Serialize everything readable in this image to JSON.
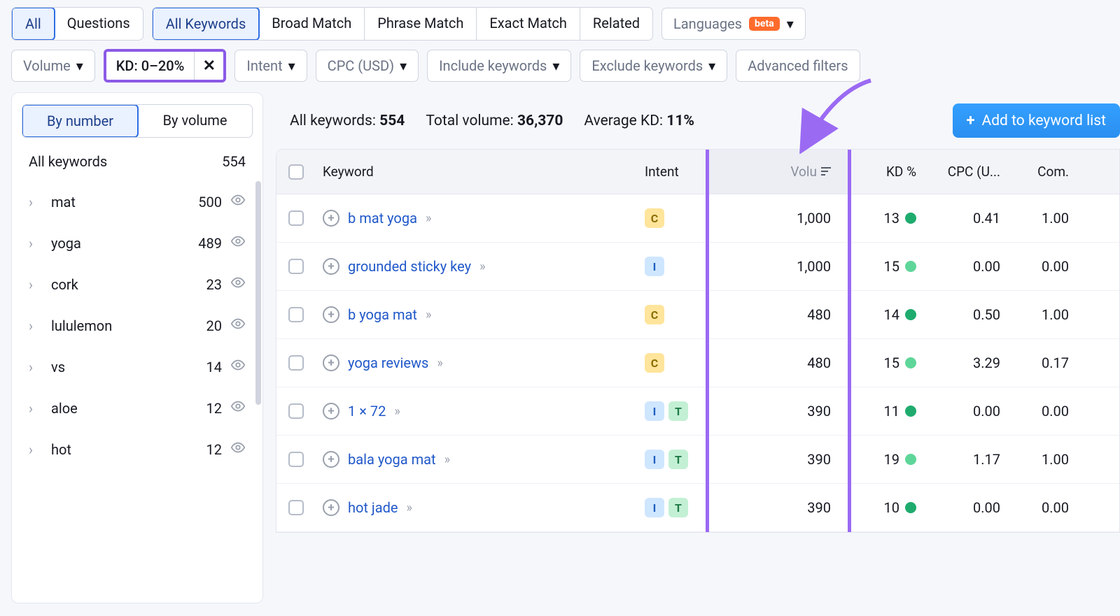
{
  "toptabs": {
    "group1": [
      {
        "label": "All",
        "active": true
      },
      {
        "label": "Questions",
        "active": false
      }
    ],
    "group2": [
      {
        "label": "All Keywords",
        "active": true
      },
      {
        "label": "Broad Match",
        "active": false
      },
      {
        "label": "Phrase Match",
        "active": false
      },
      {
        "label": "Exact Match",
        "active": false
      },
      {
        "label": "Related",
        "active": false
      }
    ],
    "languages": {
      "label": "Languages",
      "badge": "beta"
    }
  },
  "filters": {
    "volume": "Volume",
    "kd": "KD: 0–20%",
    "intent": "Intent",
    "cpc": "CPC (USD)",
    "include": "Include keywords",
    "exclude": "Exclude keywords",
    "advanced": "Advanced filters"
  },
  "sidebar": {
    "tabs": {
      "bynumber": "By number",
      "byvolume": "By volume"
    },
    "header": {
      "label": "All keywords",
      "count": "554"
    },
    "items": [
      {
        "label": "mat",
        "count": "500"
      },
      {
        "label": "yoga",
        "count": "489"
      },
      {
        "label": "cork",
        "count": "23"
      },
      {
        "label": "lululemon",
        "count": "20"
      },
      {
        "label": "vs",
        "count": "14"
      },
      {
        "label": "aloe",
        "count": "12"
      },
      {
        "label": "hot",
        "count": "12"
      }
    ]
  },
  "summary": {
    "all_label": "All keywords:",
    "all_value": "554",
    "tv_label": "Total volume:",
    "tv_value": "36,370",
    "akd_label": "Average KD:",
    "akd_value": "11%",
    "add_button": "Add to keyword list"
  },
  "headers": {
    "keyword": "Keyword",
    "intent": "Intent",
    "volume": "Volu",
    "kd": "KD %",
    "cpc": "CPC (U...",
    "com": "Com."
  },
  "rows": [
    {
      "keyword": "b mat yoga",
      "intent": [
        "C"
      ],
      "volume": "1,000",
      "kd": "13",
      "kd_color": "#1fab6e",
      "cpc": "0.41",
      "com": "1.00"
    },
    {
      "keyword": "grounded sticky key",
      "intent": [
        "I"
      ],
      "volume": "1,000",
      "kd": "15",
      "kd_color": "#5fd699",
      "cpc": "0.00",
      "com": "0.00"
    },
    {
      "keyword": "b yoga mat",
      "intent": [
        "C"
      ],
      "volume": "480",
      "kd": "14",
      "kd_color": "#1fab6e",
      "cpc": "0.50",
      "com": "1.00"
    },
    {
      "keyword": "yoga reviews",
      "intent": [
        "C"
      ],
      "volume": "480",
      "kd": "15",
      "kd_color": "#5fd699",
      "cpc": "3.29",
      "com": "0.17"
    },
    {
      "keyword": "1 × 72",
      "intent": [
        "I",
        "T"
      ],
      "volume": "390",
      "kd": "11",
      "kd_color": "#1fab6e",
      "cpc": "0.00",
      "com": "0.00"
    },
    {
      "keyword": "bala yoga mat",
      "intent": [
        "I",
        "T"
      ],
      "volume": "390",
      "kd": "19",
      "kd_color": "#5fd699",
      "cpc": "1.17",
      "com": "1.00"
    },
    {
      "keyword": "hot jade",
      "intent": [
        "I",
        "T"
      ],
      "volume": "390",
      "kd": "10",
      "kd_color": "#1fab6e",
      "cpc": "0.00",
      "com": "0.00"
    }
  ]
}
